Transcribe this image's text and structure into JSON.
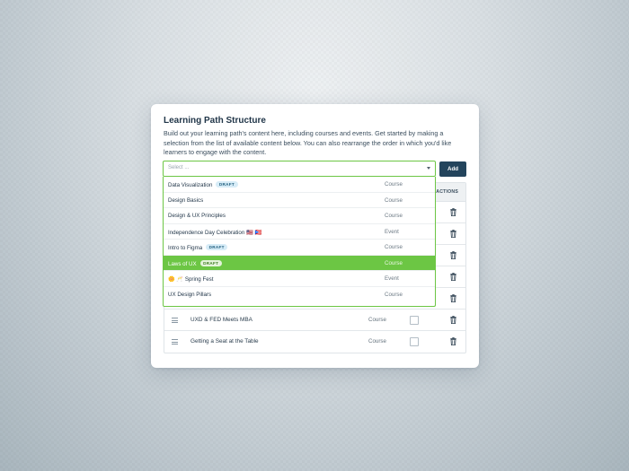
{
  "card": {
    "title": "Learning Path Structure",
    "description": "Build out your learning path's content here, including courses and events. Get started by making a selection from the list of available content below. You can also rearrange the order in which you'd like learners to engage with the content."
  },
  "select": {
    "placeholder": "Select ...",
    "add_label": "Add"
  },
  "dropdown": {
    "options": [
      {
        "name": "Data Visualization",
        "badge": "DRAFT",
        "type": "Course",
        "selected": false
      },
      {
        "name": "Design Basics",
        "badge": "",
        "type": "Course",
        "selected": false
      },
      {
        "name": "Design & UX Principles",
        "badge": "",
        "type": "Course",
        "selected": false
      },
      {
        "name": "Independence Day Celebration 🇺🇸 🇵🇷",
        "badge": "",
        "type": "Event",
        "selected": false
      },
      {
        "name": "Intro to Figma",
        "badge": "DRAFT",
        "type": "Course",
        "selected": false
      },
      {
        "name": "Laws of UX",
        "badge": "DRAFT",
        "type": "Course",
        "selected": true
      },
      {
        "name": "🌼 🥂 Spring Fest",
        "badge": "",
        "type": "Event",
        "selected": false
      },
      {
        "name": "UX Design Pillars",
        "badge": "",
        "type": "Course",
        "selected": false
      }
    ]
  },
  "table": {
    "actions_header": "ACTIONS",
    "rows": [
      {
        "name": "",
        "type": ""
      },
      {
        "name": "",
        "type": ""
      },
      {
        "name": "",
        "type": ""
      },
      {
        "name": "",
        "type": ""
      },
      {
        "name": "",
        "type": ""
      },
      {
        "name": "UXD & FED Meets MBA",
        "type": "Course"
      },
      {
        "name": "Getting a Seat at the Table",
        "type": "Course"
      }
    ]
  },
  "colors": {
    "accent_green": "#6cc644",
    "button_navy": "#23445c",
    "draft_badge_bg": "#d7ecf7"
  }
}
